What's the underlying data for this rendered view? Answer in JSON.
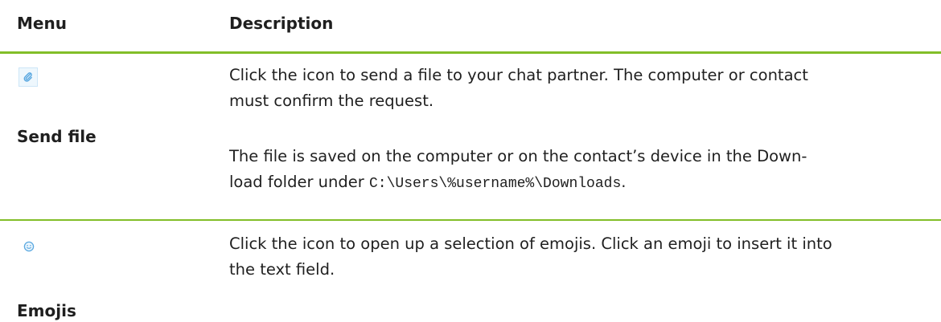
{
  "header": {
    "menu": "Menu",
    "description": "Description"
  },
  "rows": [
    {
      "icon": "paperclip-icon",
      "menu": "Send file",
      "paragraphs": [
        "Click the icon to send a file to your chat partner. The computer or contact must confirm the request.",
        "The file is saved on the computer or on the contact’s device in the Down-load folder under "
      ],
      "path": "C:\\Users\\%username%\\Downloads",
      "path_suffix": "."
    },
    {
      "icon": "smiley-icon",
      "menu": "Emojis",
      "paragraphs": [
        "Click the icon to open up a selection of emojis. Click an emoji to insert it into the text field."
      ]
    }
  ],
  "colors": {
    "rule": "#82be28",
    "icon_accent": "#5aa8e0"
  }
}
